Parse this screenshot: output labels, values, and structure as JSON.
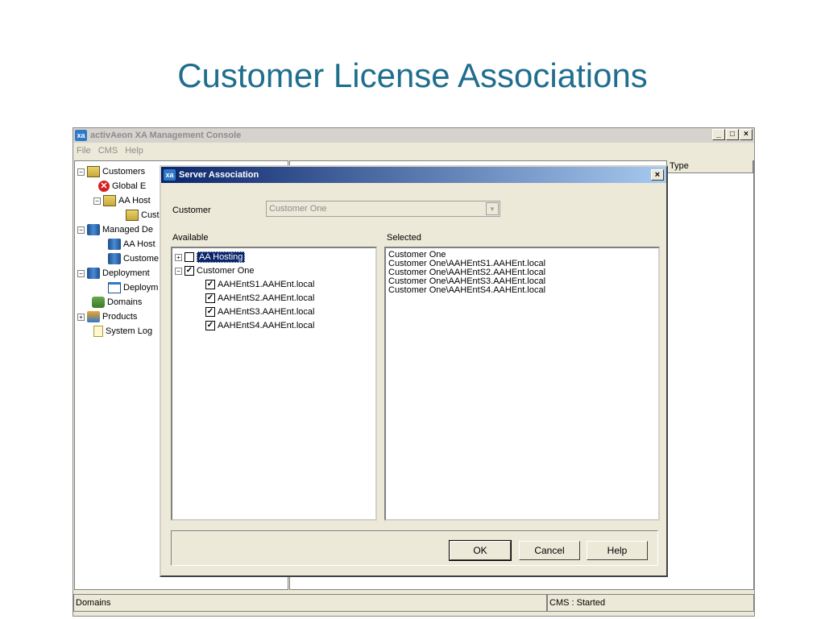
{
  "slide": {
    "title": "Customer License Associations"
  },
  "window": {
    "icon_text": "xa",
    "title": "activAeon XA Management Console",
    "controls": {
      "minimize": "_",
      "maximize": "□",
      "close": "×"
    },
    "menu": [
      "File",
      "CMS",
      "Help"
    ],
    "type_column": "Type"
  },
  "tree": {
    "customers": "Customers",
    "global": "Global E",
    "aa_host": "AA Host",
    "cust": "Cust",
    "managed": "Managed De",
    "managed_aa_host": "AA Host",
    "managed_customer": "Custome",
    "deployment": "Deployment",
    "deploym": "Deploym",
    "domains": "Domains",
    "products": "Products",
    "system_log": "System Log"
  },
  "status": {
    "left": "Domains",
    "right": "CMS : Started"
  },
  "dialog": {
    "icon_text": "xa",
    "title": "Server Association",
    "close": "×",
    "customer_label": "Customer",
    "customer_value": "Customer One",
    "available_label": "Available",
    "selected_label": "Selected",
    "available": {
      "aa_hosting": "AA Hosting",
      "customer_one": "Customer One",
      "servers": [
        "AAHEntS1.AAHEnt.local",
        "AAHEntS2.AAHEnt.local",
        "AAHEntS3.AAHEnt.local",
        "AAHEntS4.AAHEnt.local"
      ]
    },
    "selected": [
      "Customer One",
      "Customer One\\AAHEntS1.AAHEnt.local",
      "Customer One\\AAHEntS2.AAHEnt.local",
      "Customer One\\AAHEntS3.AAHEnt.local",
      "Customer One\\AAHEntS4.AAHEnt.local"
    ],
    "buttons": {
      "ok": "OK",
      "cancel": "Cancel",
      "help": "Help"
    }
  }
}
